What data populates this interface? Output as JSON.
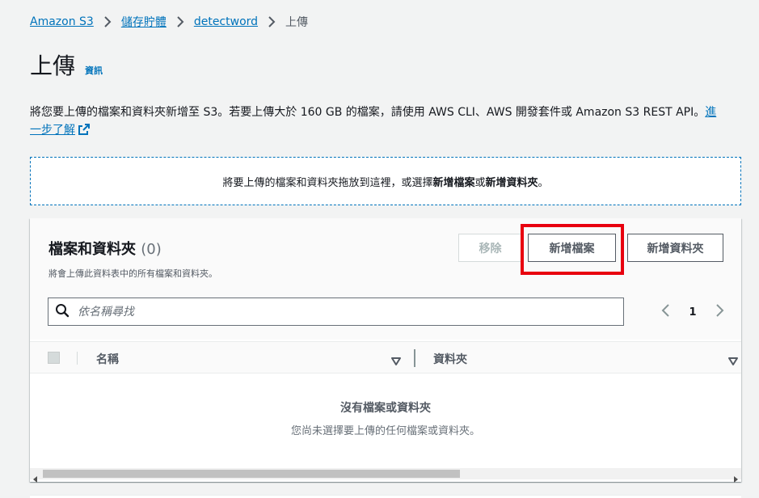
{
  "breadcrumb": {
    "items": [
      "Amazon S3",
      "儲存貯體",
      "detectword"
    ],
    "current": "上傳"
  },
  "page": {
    "title": "上傳",
    "info_link": "資訊",
    "description": "將您要上傳的檔案和資料夾新增至 S3。若要上傳大於 160 GB 的檔案，請使用 AWS CLI、AWS 開發套件或 Amazon S3 REST API。",
    "learn_more": "進一步了解"
  },
  "dropzone": {
    "text_before": "將要上傳的檔案和資料夾拖放到這裡，或選擇",
    "add_files": "新增檔案",
    "or": "或",
    "add_folder": "新增資料夾",
    "text_after": "。"
  },
  "panel": {
    "title": "檔案和資料夾",
    "count": "(0)",
    "description": "將會上傳此資料表中的所有檔案和資料夾。",
    "buttons": {
      "remove": "移除",
      "add_files": "新增檔案",
      "add_folder": "新增資料夾"
    },
    "search": {
      "placeholder": "依名稱尋找"
    },
    "pagination": {
      "page": "1"
    },
    "columns": [
      "名稱",
      "資料夾"
    ],
    "empty": {
      "title": "沒有檔案或資料夾",
      "description": "您尚未選擇要上傳的任何檔案或資料夾。"
    }
  },
  "colors": {
    "link": "#0073bb",
    "highlight": "#e8000f",
    "background": "#f2f3f3"
  },
  "icons": [
    "chevron-right-icon",
    "external-link-icon",
    "search-icon",
    "chevron-left-icon",
    "sort-caret-icon"
  ]
}
